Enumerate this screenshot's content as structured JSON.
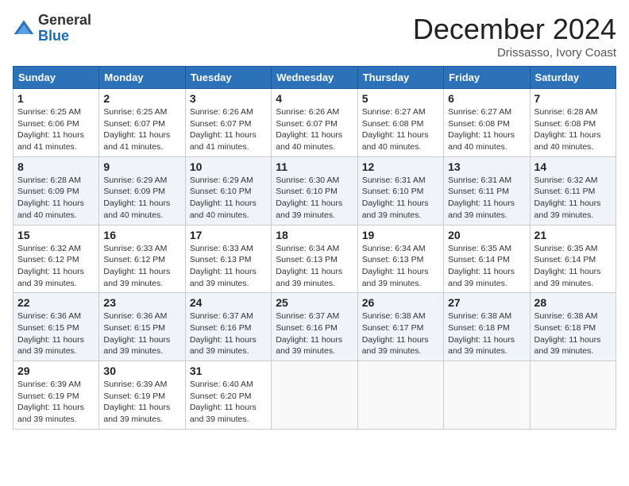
{
  "header": {
    "logo_line1": "General",
    "logo_line2": "Blue",
    "month_year": "December 2024",
    "location": "Drissasso, Ivory Coast"
  },
  "weekdays": [
    "Sunday",
    "Monday",
    "Tuesday",
    "Wednesday",
    "Thursday",
    "Friday",
    "Saturday"
  ],
  "weeks": [
    [
      {
        "day": "1",
        "sunrise": "6:25 AM",
        "sunset": "6:06 PM",
        "daylight": "11 hours and 41 minutes."
      },
      {
        "day": "2",
        "sunrise": "6:25 AM",
        "sunset": "6:07 PM",
        "daylight": "11 hours and 41 minutes."
      },
      {
        "day": "3",
        "sunrise": "6:26 AM",
        "sunset": "6:07 PM",
        "daylight": "11 hours and 41 minutes."
      },
      {
        "day": "4",
        "sunrise": "6:26 AM",
        "sunset": "6:07 PM",
        "daylight": "11 hours and 40 minutes."
      },
      {
        "day": "5",
        "sunrise": "6:27 AM",
        "sunset": "6:08 PM",
        "daylight": "11 hours and 40 minutes."
      },
      {
        "day": "6",
        "sunrise": "6:27 AM",
        "sunset": "6:08 PM",
        "daylight": "11 hours and 40 minutes."
      },
      {
        "day": "7",
        "sunrise": "6:28 AM",
        "sunset": "6:08 PM",
        "daylight": "11 hours and 40 minutes."
      }
    ],
    [
      {
        "day": "8",
        "sunrise": "6:28 AM",
        "sunset": "6:09 PM",
        "daylight": "11 hours and 40 minutes."
      },
      {
        "day": "9",
        "sunrise": "6:29 AM",
        "sunset": "6:09 PM",
        "daylight": "11 hours and 40 minutes."
      },
      {
        "day": "10",
        "sunrise": "6:29 AM",
        "sunset": "6:10 PM",
        "daylight": "11 hours and 40 minutes."
      },
      {
        "day": "11",
        "sunrise": "6:30 AM",
        "sunset": "6:10 PM",
        "daylight": "11 hours and 39 minutes."
      },
      {
        "day": "12",
        "sunrise": "6:31 AM",
        "sunset": "6:10 PM",
        "daylight": "11 hours and 39 minutes."
      },
      {
        "day": "13",
        "sunrise": "6:31 AM",
        "sunset": "6:11 PM",
        "daylight": "11 hours and 39 minutes."
      },
      {
        "day": "14",
        "sunrise": "6:32 AM",
        "sunset": "6:11 PM",
        "daylight": "11 hours and 39 minutes."
      }
    ],
    [
      {
        "day": "15",
        "sunrise": "6:32 AM",
        "sunset": "6:12 PM",
        "daylight": "11 hours and 39 minutes."
      },
      {
        "day": "16",
        "sunrise": "6:33 AM",
        "sunset": "6:12 PM",
        "daylight": "11 hours and 39 minutes."
      },
      {
        "day": "17",
        "sunrise": "6:33 AM",
        "sunset": "6:13 PM",
        "daylight": "11 hours and 39 minutes."
      },
      {
        "day": "18",
        "sunrise": "6:34 AM",
        "sunset": "6:13 PM",
        "daylight": "11 hours and 39 minutes."
      },
      {
        "day": "19",
        "sunrise": "6:34 AM",
        "sunset": "6:13 PM",
        "daylight": "11 hours and 39 minutes."
      },
      {
        "day": "20",
        "sunrise": "6:35 AM",
        "sunset": "6:14 PM",
        "daylight": "11 hours and 39 minutes."
      },
      {
        "day": "21",
        "sunrise": "6:35 AM",
        "sunset": "6:14 PM",
        "daylight": "11 hours and 39 minutes."
      }
    ],
    [
      {
        "day": "22",
        "sunrise": "6:36 AM",
        "sunset": "6:15 PM",
        "daylight": "11 hours and 39 minutes."
      },
      {
        "day": "23",
        "sunrise": "6:36 AM",
        "sunset": "6:15 PM",
        "daylight": "11 hours and 39 minutes."
      },
      {
        "day": "24",
        "sunrise": "6:37 AM",
        "sunset": "6:16 PM",
        "daylight": "11 hours and 39 minutes."
      },
      {
        "day": "25",
        "sunrise": "6:37 AM",
        "sunset": "6:16 PM",
        "daylight": "11 hours and 39 minutes."
      },
      {
        "day": "26",
        "sunrise": "6:38 AM",
        "sunset": "6:17 PM",
        "daylight": "11 hours and 39 minutes."
      },
      {
        "day": "27",
        "sunrise": "6:38 AM",
        "sunset": "6:18 PM",
        "daylight": "11 hours and 39 minutes."
      },
      {
        "day": "28",
        "sunrise": "6:38 AM",
        "sunset": "6:18 PM",
        "daylight": "11 hours and 39 minutes."
      }
    ],
    [
      {
        "day": "29",
        "sunrise": "6:39 AM",
        "sunset": "6:19 PM",
        "daylight": "11 hours and 39 minutes."
      },
      {
        "day": "30",
        "sunrise": "6:39 AM",
        "sunset": "6:19 PM",
        "daylight": "11 hours and 39 minutes."
      },
      {
        "day": "31",
        "sunrise": "6:40 AM",
        "sunset": "6:20 PM",
        "daylight": "11 hours and 39 minutes."
      },
      null,
      null,
      null,
      null
    ]
  ]
}
